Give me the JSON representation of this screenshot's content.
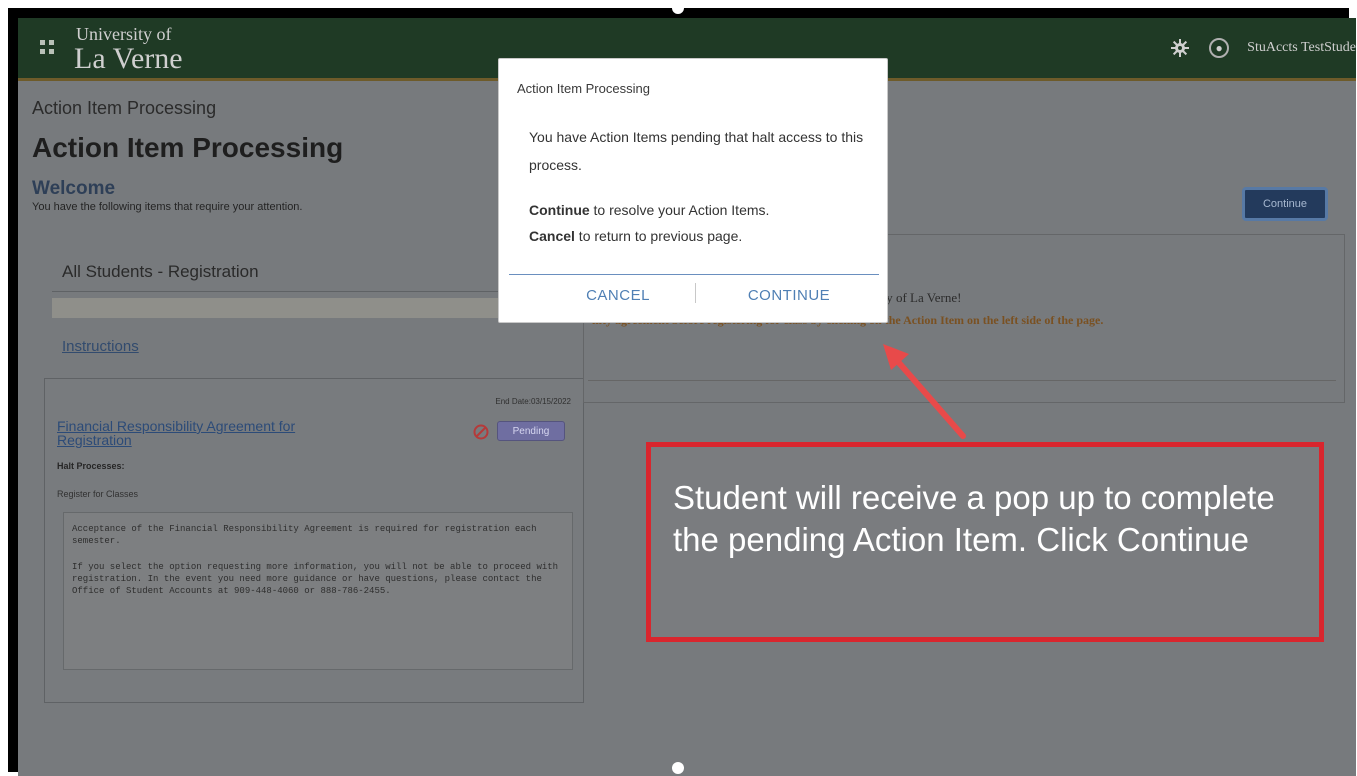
{
  "header": {
    "logo_line1": "University of",
    "logo_line2": "La Verne",
    "user_name": "StuAccts TestStude"
  },
  "page": {
    "breadcrumb": "Action Item Processing",
    "title": "Action Item Processing",
    "welcome_title": "Welcome",
    "welcome_sub": "You have the following items that require your attention.",
    "continue_label": "Continue"
  },
  "left": {
    "section_title": "All Students - Registration",
    "instructions_label": "Instructions",
    "item": {
      "end_date": "End Date:03/15/2022",
      "title": "Financial Responsibility Agreement for Registration",
      "status": "Pending",
      "halt_label": "Halt Processes:",
      "halt_value": "Register for Classes",
      "body_p1": "  Acceptance of the Financial Responsibility Agreement is required for registration each semester.",
      "body_p2": "If you select the option requesting more information, you will not be able to proceed with registration.  In the event you need more guidance or have questions, please contact the Office of Student Accounts at 909-448-4060 or 888-786-2455."
    }
  },
  "right": {
    "line1": "ity of La Verne!",
    "line2": "ility agreement before registering for class by clicking on the Action Item on the left side of the page."
  },
  "modal": {
    "title": "Action Item Processing",
    "message": "You have Action Items pending that halt access to this process.",
    "continue_bold": "Continue",
    "continue_text": " to resolve your Action Items.",
    "cancel_bold": "Cancel",
    "cancel_text": " to return to previous page.",
    "cancel_label": "CANCEL",
    "continue_label": "CONTINUE"
  },
  "annotation": {
    "text": "Student will receive a pop up to complete the pending Action Item. Click Continue"
  },
  "colors": {
    "header_bg": "#1f3a25",
    "accent_red": "#d9262e",
    "modal_button": "#4f7fb4"
  }
}
